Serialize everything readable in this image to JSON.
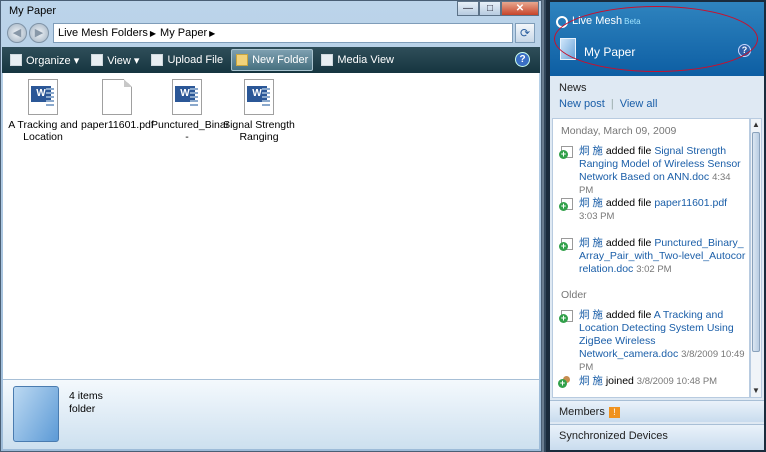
{
  "window": {
    "title": "My Paper",
    "minimize": "—",
    "maximize": "□",
    "close": "✕"
  },
  "address": {
    "back": "◀",
    "forward": "▶",
    "crumbs": [
      "Live Mesh Folders",
      "My Paper"
    ],
    "separator": "▶",
    "refresh": "⟳"
  },
  "toolbar": {
    "items": [
      "Organize ▾",
      "View ▾",
      "Upload File",
      "New Folder",
      "Media View"
    ],
    "help": "?"
  },
  "files": [
    {
      "name": "A Tracking and Location",
      "type": "doc"
    },
    {
      "name": "paper11601.pdf",
      "type": "pdf"
    },
    {
      "name": "Punctured_Binar -",
      "type": "doc"
    },
    {
      "name": "Signal Strength Ranging",
      "type": "doc"
    }
  ],
  "details": {
    "count": "4 items",
    "type": "folder"
  },
  "mesh": {
    "brand": "Live Mesh",
    "beta": "Beta",
    "folder_title": "My Paper",
    "help": "?",
    "news_label": "News",
    "new_post": "New post",
    "view_all": "View all",
    "date_today": "Monday, March 09, 2009",
    "date_older": "Older",
    "feed": [
      {
        "user": "炯 施",
        "action": "added file",
        "file": "Signal Strength Ranging Model of Wireless Sensor Network Based on ANN.doc",
        "time": "4:34 PM"
      },
      {
        "user": "炯 施",
        "action": "added file",
        "file": "paper11601.pdf",
        "time": "3:03 PM"
      },
      {
        "user": "炯 施",
        "action": "added file",
        "file": "Punctured_Binary_Array_Pair_with_Two-level_Autocorrelation.doc",
        "time": "3:02 PM"
      },
      {
        "user": "炯 施",
        "action": "added file",
        "file": "A Tracking and Location Detecting System Using ZigBee Wireless Network_camera.doc",
        "time": "3/8/2009 10:49 PM"
      },
      {
        "user": "炯 施",
        "action": "joined",
        "file": "",
        "time": "3/8/2009 10:48 PM"
      }
    ],
    "members_label": "Members",
    "members_badge": "!",
    "sync_label": "Synchronized Devices"
  }
}
